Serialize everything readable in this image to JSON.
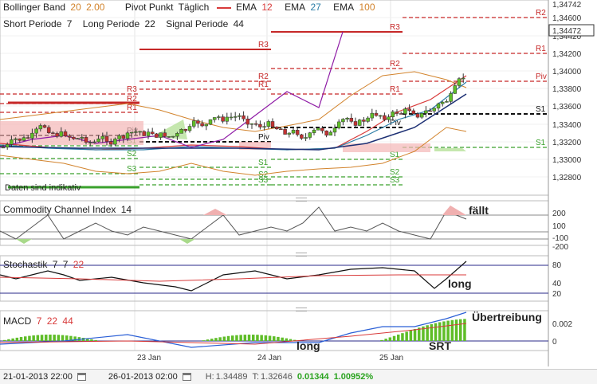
{
  "legend": {
    "bollinger": {
      "label": "Bollinger Band",
      "p1": "20",
      "p2": "2.00"
    },
    "pivot": {
      "label": "Pivot Punkt",
      "mode": "Täglich"
    },
    "ema": [
      {
        "label": "EMA",
        "value": "12",
        "color": "#d83a3a"
      },
      {
        "label": "EMA",
        "value": "27",
        "color": "#2a7ca6"
      },
      {
        "label": "EMA",
        "value": "100",
        "color": "#333333"
      }
    ],
    "short": {
      "label": "Short Periode",
      "value": "7"
    },
    "long": {
      "label": "Long Periode",
      "value": "22"
    },
    "signal": {
      "label": "Signal Periode",
      "value": "44"
    }
  },
  "price_axis": {
    "ticks": [
      "1,34600",
      "1,34420",
      "1,34200",
      "1,34000",
      "1,33800",
      "1,33600",
      "1,33400",
      "1,33200",
      "1,33000",
      "1,32800"
    ],
    "top": "1,34742",
    "current": "1,34472"
  },
  "disclaimer": "Daten sind indikativ",
  "pivot_labels": [
    "R3",
    "R2",
    "R1",
    "Piv",
    "S1",
    "S2",
    "S3"
  ],
  "cci": {
    "label": "Commodity Channel Index",
    "period": "14",
    "ticks": [
      "200",
      "100",
      "-100",
      "-200"
    ],
    "annotation": "fällt"
  },
  "stoch": {
    "label": "Stochastik",
    "p1": "7",
    "p2": "7",
    "p3": "22",
    "ticks": [
      "80",
      "40",
      "20"
    ],
    "annotation": "long"
  },
  "macd": {
    "label": "MACD",
    "p1": "7",
    "p2": "22",
    "p3": "44",
    "ticks": [
      "0.002",
      "0"
    ],
    "annotations": [
      "Übertreibung",
      "long",
      "SRT"
    ]
  },
  "dates": [
    "23 Jan",
    "24 Jan",
    "25 Jan"
  ],
  "footer": {
    "from": "21-01-2013 22:00",
    "to": "26-01-2013 02:00",
    "high_label": "H:",
    "high": "1.34489",
    "low_label": "T:",
    "low": "1.32646",
    "change": "0.01344",
    "change_pct": "1.00952%"
  },
  "colors": {
    "bull": "#5fbd28",
    "bear": "#c23232",
    "pivot_r": "#c62828",
    "pivot_s": "#3aa12c",
    "bollinger": "#d2832c",
    "purple": "#8e1aa5",
    "grid": "#e6e6e6"
  }
}
